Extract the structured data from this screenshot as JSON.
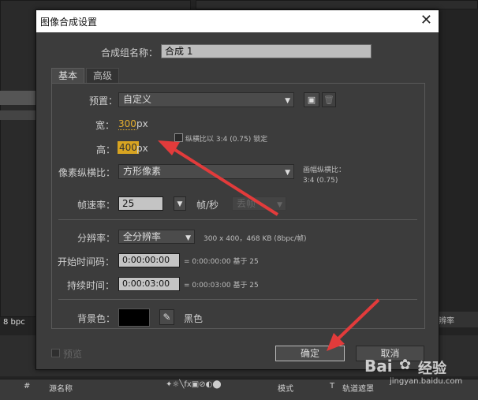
{
  "dialog": {
    "title": "图像合成设置",
    "close_glyph": "✕",
    "comp_name_label": "合成组名称：",
    "comp_name_value": "合成 1",
    "tabs": [
      "基本",
      "高级"
    ],
    "preset_label": "预置：",
    "preset_value": "自定义",
    "width_label": "宽：",
    "width_value": "300",
    "height_label": "高：",
    "height_value": "400",
    "unit_px": "px",
    "lock_aspect_label": "纵横比以 3:4 (0.75) 锁定",
    "pixel_aspect_label": "像素纵横比：",
    "pixel_aspect_value": "方形像素",
    "frame_aspect_label": "画幅纵横比：",
    "frame_aspect_value": "3:4 (0.75)",
    "frame_rate_label": "帧速率：",
    "frame_rate_value": "25",
    "fps_unit": "帧/秒",
    "frame_drop_value": "丢帧",
    "resolution_label": "分辨率：",
    "resolution_value": "全分辨率",
    "resolution_info": "300 x 400，468 KB (8bpc/帧)",
    "start_timecode_label": "开始时间码：",
    "start_timecode_value": "0:00:00:00",
    "start_timecode_info": "= 0:00:00:00  基于 25",
    "duration_label": "持续时间：",
    "duration_value": "0:00:03:00",
    "duration_info": "= 0:00:03:00  基于 25",
    "bg_color_label": "背景色：",
    "bg_color_name": "黑色",
    "bg_color_hex": "#000000",
    "preview_label": "预览",
    "ok_label": "确定",
    "cancel_label": "取消"
  },
  "background_app": {
    "bpc_label": "8 bpc",
    "layer_header": [
      "#",
      "源名称",
      "模式",
      "T",
      "轨道遮罩"
    ],
    "render_partial": "辨率"
  },
  "watermark": {
    "brand": "Bai",
    "brand2": "经验",
    "url": "jingyan.baidu.com"
  },
  "annotation": {
    "arrow_color": "#e23b3b"
  }
}
